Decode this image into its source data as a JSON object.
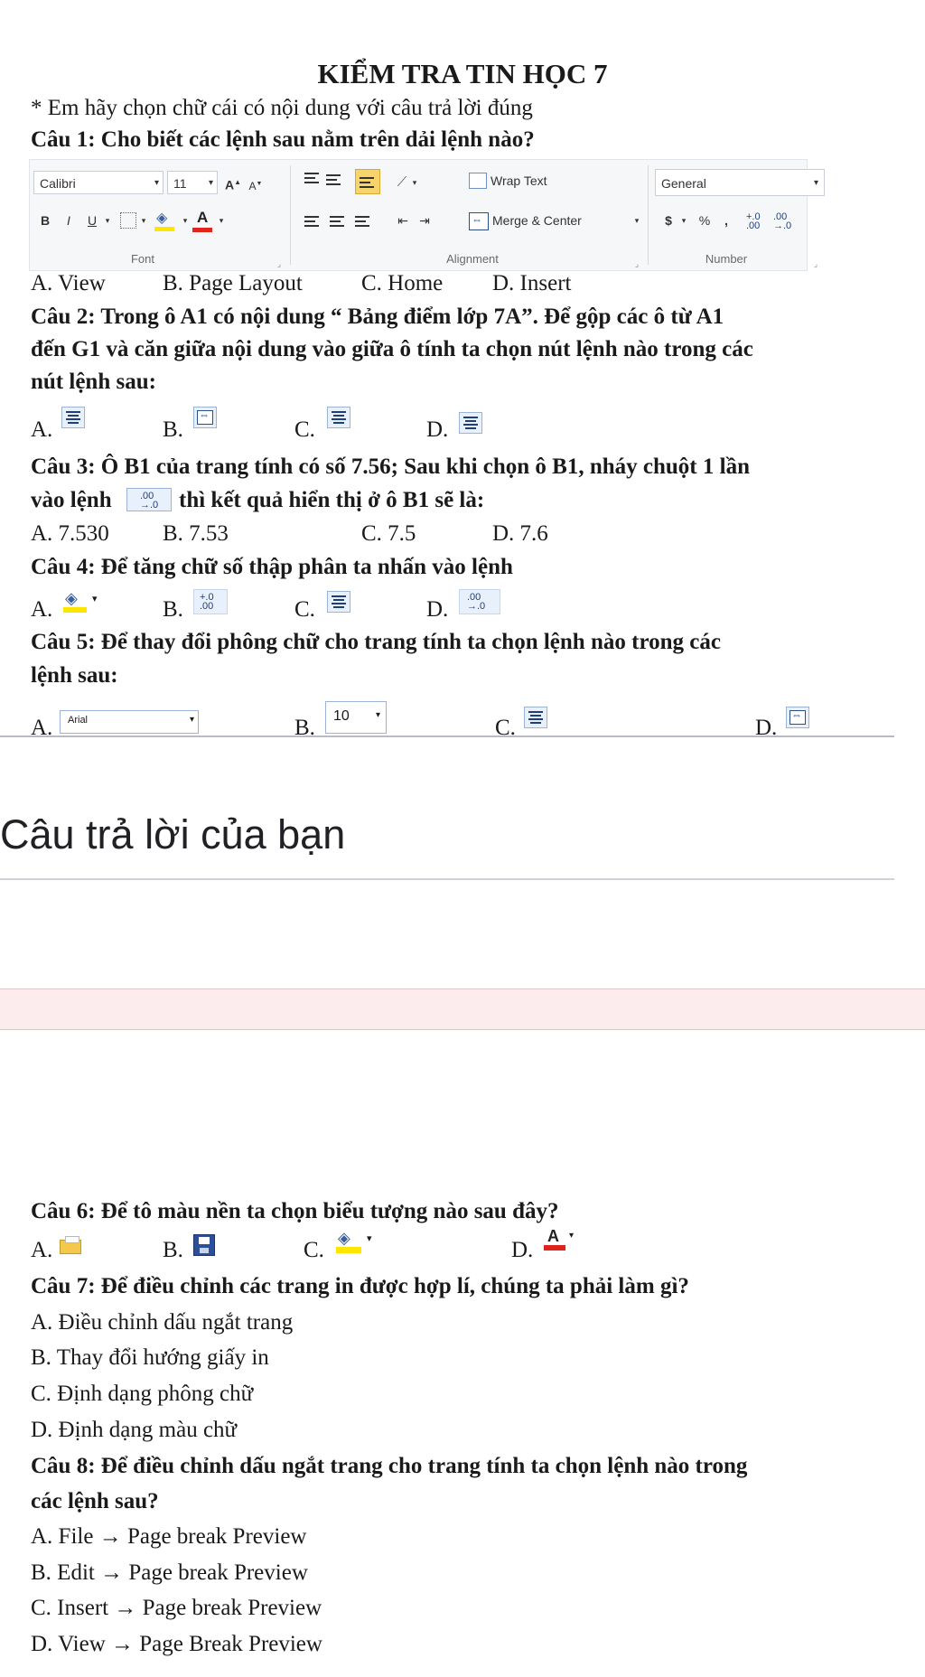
{
  "title": "KIỂM TRA TIN HỌC 7",
  "instruction": "* Em hãy chọn chữ cái có nội dung với câu trả lời đúng",
  "q1": {
    "text": "Câu 1: Cho biết các lệnh sau nằm trên dải lệnh nào?",
    "ribbon": {
      "font_name": "Calibri",
      "font_size": "11",
      "grow_font": "A",
      "shrink_font": "A",
      "bold": "B",
      "italic": "I",
      "underline": "U",
      "font_color_letter": "A",
      "wrap_text": "Wrap Text",
      "merge_center": "Merge & Center",
      "number_format": "General",
      "currency": "$",
      "percent": "%",
      "comma": ",",
      "group_font": "Font",
      "group_alignment": "Alignment",
      "group_number": "Number"
    },
    "options": [
      "A. View",
      "B. Page Layout",
      "C. Home",
      "D. Insert"
    ]
  },
  "q2": {
    "line1": "Câu 2: Trong ô A1 có  nội dung “ Bảng điểm lớp 7A”. Để gộp các ô từ A1",
    "line2": "đến G1 và căn giữa nội dung vào giữa ô tính ta chọn nút lệnh nào trong các",
    "line3": "nút lệnh sau:",
    "labels": [
      "A.",
      "B.",
      "C.",
      "D."
    ]
  },
  "q3": {
    "line1": "Câu 3: Ô B1 của trang tính có số 7.56; Sau khi chọn ô B1, nháy chuột 1 lần",
    "line2_pre": "vào lệnh",
    "line2_post": "thì kết quả hiển thị ở ô B1 sẽ là:",
    "options": [
      "A. 7.530",
      "B. 7.53",
      "C. 7.5",
      "D. 7.6"
    ]
  },
  "q4": {
    "text": "Câu 4: Để tăng chữ số thập phân ta nhấn vào lệnh",
    "labels": [
      "A.",
      "B.",
      "C.",
      "D."
    ]
  },
  "q5": {
    "line1": "Câu 5: Để thay đổi phông chữ cho trang tính ta chọn lệnh nào trong các",
    "line2": "lệnh sau:",
    "labels": [
      "A.",
      "B.",
      "C.",
      "D."
    ],
    "font_box": "Arial",
    "size_box": "10"
  },
  "answer_heading": "Câu trả lời của bạn",
  "q6": {
    "text": "Câu 6: Để tô màu nền ta chọn biểu tượng nào sau đây?",
    "labels": [
      "A.",
      "B.",
      "C.",
      "D."
    ],
    "font_color_letter": "A"
  },
  "q7": {
    "text": "Câu 7: Để điều chỉnh các trang in  được hợp lí,  chúng ta phải làm gì?",
    "options": [
      "A. Điều chỉnh dấu ngắt trang",
      "B. Thay đổi hướng giấy in",
      "C. Định dạng phông chữ",
      "D. Định dạng màu chữ"
    ]
  },
  "q8": {
    "line1": "Câu 8: Để điều chỉnh dấu ngắt trang cho trang tính ta chọn lệnh nào trong",
    "line2": "các lệnh sau?",
    "options": [
      "A. File → Page break Preview",
      "B. Edit → Page break Preview",
      "C. Insert → Page break Preview",
      "D. View → Page Break Preview"
    ]
  }
}
